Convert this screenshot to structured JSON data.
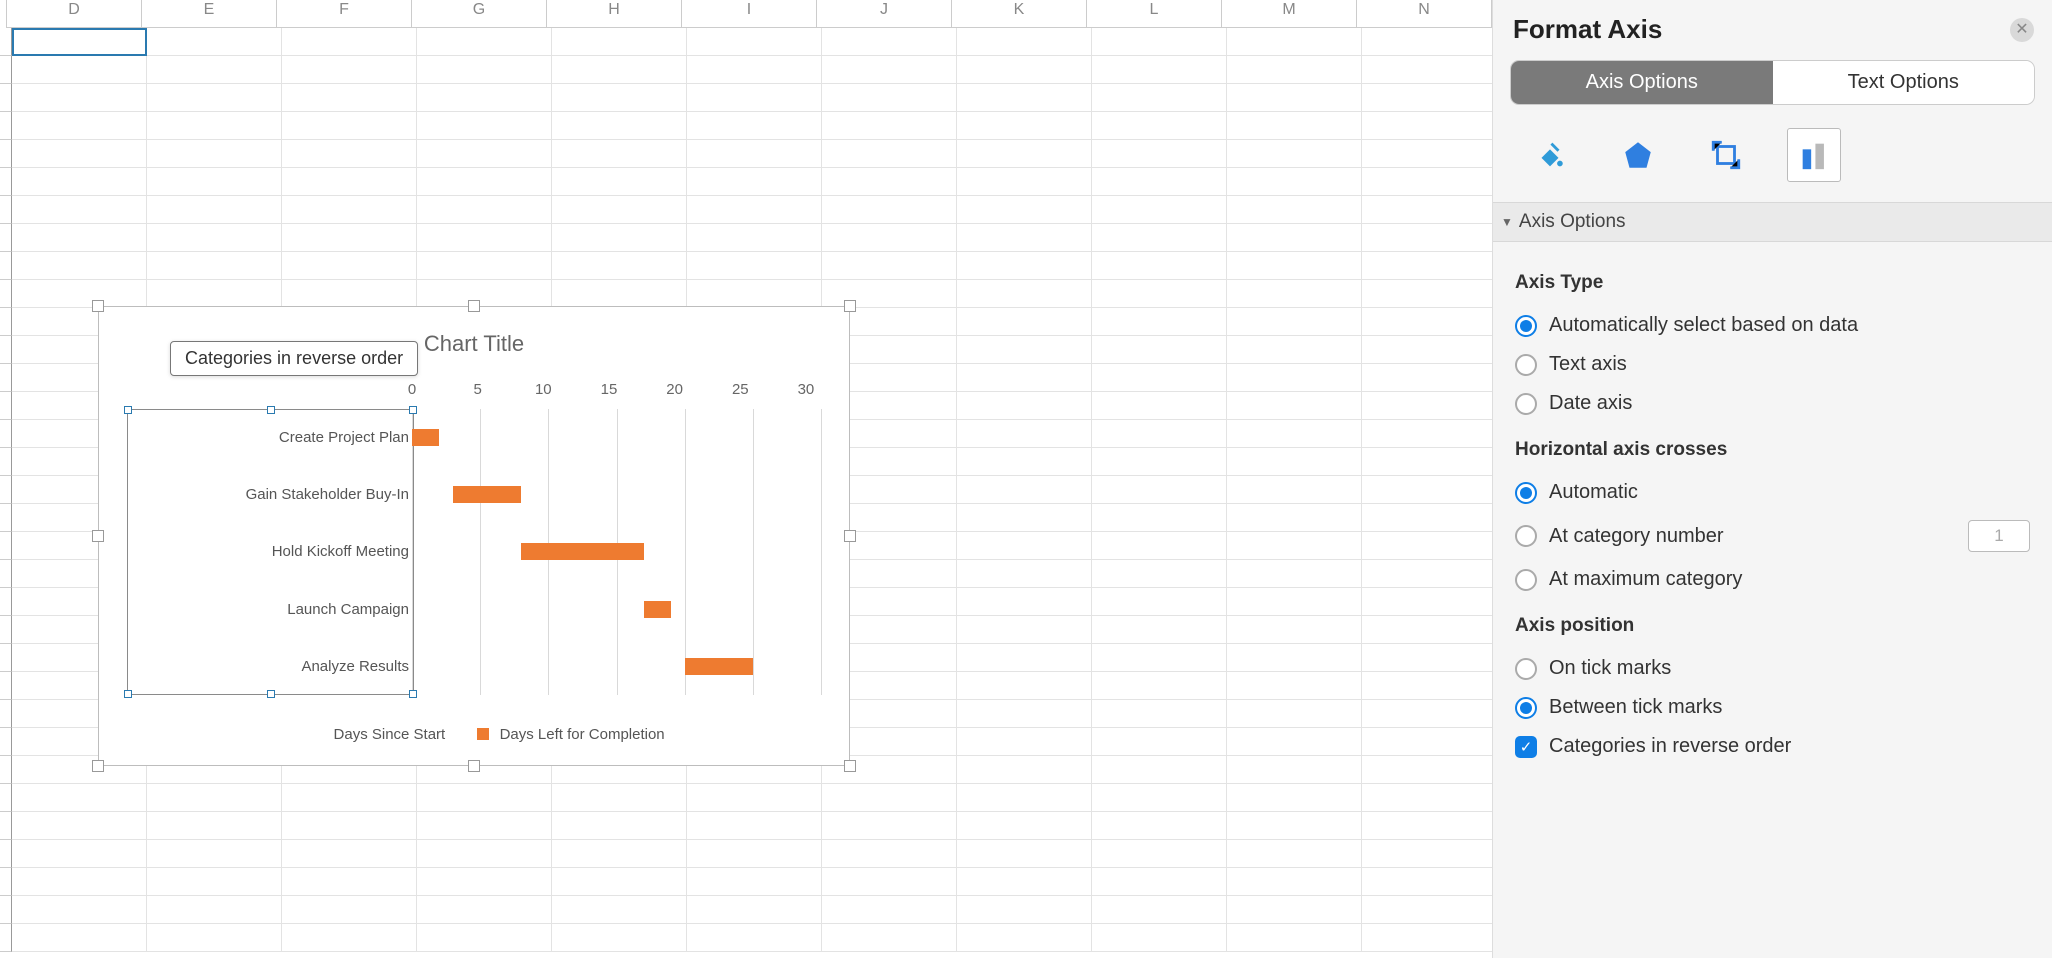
{
  "columns": [
    "D",
    "E",
    "F",
    "G",
    "H",
    "I",
    "J",
    "K",
    "L",
    "M",
    "N"
  ],
  "tooltip": "Categories in reverse order",
  "chart_data": {
    "type": "bar",
    "title": "Chart Title",
    "orientation": "horizontal",
    "stacked": true,
    "categories": [
      "Create Project Plan",
      "Gain Stakeholder Buy-In",
      "Hold Kickoff Meeting",
      "Launch Campaign",
      "Analyze Results"
    ],
    "x": [
      0,
      5,
      10,
      15,
      20,
      25,
      30
    ],
    "series": [
      {
        "name": "Days Since Start",
        "visible": false,
        "values": [
          0,
          3,
          8,
          17,
          20
        ]
      },
      {
        "name": "Days Left for Completion",
        "visible": true,
        "values": [
          2,
          5,
          9,
          2,
          5
        ]
      }
    ],
    "xlim": [
      0,
      30
    ]
  },
  "panel": {
    "title": "Format Axis",
    "tabs": {
      "axis_options": "Axis Options",
      "text_options": "Text Options",
      "active": "axis_options"
    },
    "icon_tabs": [
      "fill",
      "effects",
      "size",
      "chart"
    ],
    "icon_active": "chart",
    "section_title": "Axis Options",
    "groups": {
      "axis_type": {
        "label": "Axis Type",
        "options": [
          "Automatically select based on data",
          "Text axis",
          "Date axis"
        ],
        "selected": 0
      },
      "hcrosses": {
        "label": "Horizontal axis crosses",
        "options": [
          "Automatic",
          "At category number",
          "At maximum category"
        ],
        "selected": 0,
        "cat_number": "1"
      },
      "axis_pos": {
        "label": "Axis position",
        "options": [
          "On tick marks",
          "Between tick marks"
        ],
        "selected": 1,
        "reverse_label": "Categories in reverse order",
        "reverse_checked": true
      }
    }
  }
}
